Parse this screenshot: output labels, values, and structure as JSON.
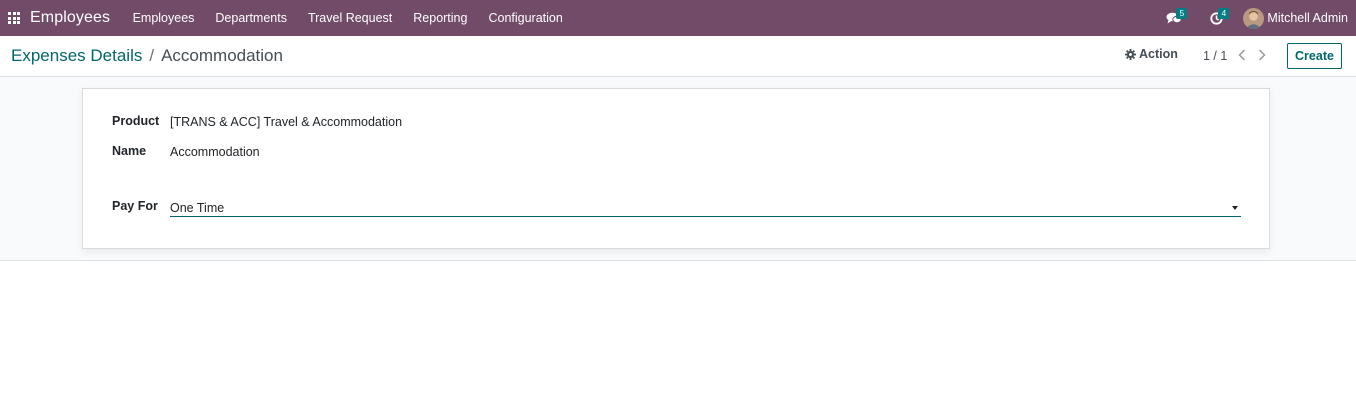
{
  "navbar": {
    "app_name": "Employees",
    "menu": [
      "Employees",
      "Departments",
      "Travel Request",
      "Reporting",
      "Configuration"
    ],
    "messages_count": "5",
    "activities_count": "4",
    "user_name": "Mitchell Admin"
  },
  "breadcrumb": {
    "parent": "Expenses Details",
    "separator": "/",
    "current": "Accommodation"
  },
  "toolbar": {
    "action_label": "Action",
    "pager": "1 / 1",
    "create_label": "Create"
  },
  "form": {
    "product_label": "Product",
    "product_value": "[TRANS & ACC] Travel & Accommodation",
    "name_label": "Name",
    "name_value": "Accommodation",
    "pay_for_label": "Pay For",
    "pay_for_value": "One Time"
  },
  "colors": {
    "navbar": "#714b67",
    "accent": "#01666b",
    "badge": "#017e84"
  }
}
